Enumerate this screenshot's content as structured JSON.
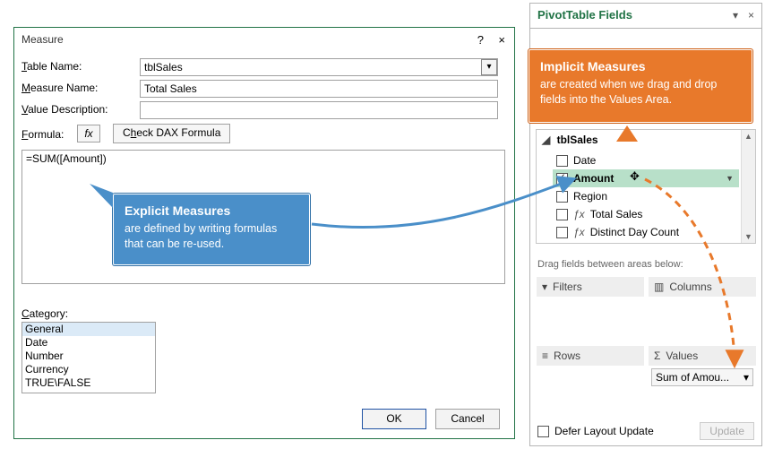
{
  "dialog": {
    "title": "Measure",
    "help": "?",
    "close": "×",
    "tablename_label": "Table Name:",
    "tablename_value": "tblSales",
    "measurename_label": "Measure Name:",
    "measurename_value": "Total Sales",
    "valuedesc_label": "Value Description:",
    "valuedesc_value": "",
    "formula_label": "Formula:",
    "fx_label": "fx",
    "checkdax_label": "Check DAX Formula",
    "formula_text": "=SUM([Amount])",
    "category_label": "Category:",
    "categories": [
      "General",
      "Date",
      "Number",
      "Currency",
      "TRUE\\FALSE"
    ],
    "ok_label": "OK",
    "cancel_label": "Cancel",
    "underline_chars": {
      "tablename": "T",
      "measurename": "M",
      "valuedesc": "V",
      "formula": "F",
      "checkdax": "h",
      "category": "C"
    }
  },
  "pane": {
    "title": "PivotTable Fields",
    "table_header": "tblSales",
    "fields": [
      {
        "name": "Date",
        "checked": false,
        "fx": false
      },
      {
        "name": "Amount",
        "checked": true,
        "fx": false,
        "active": true
      },
      {
        "name": "Region",
        "checked": false,
        "fx": false
      },
      {
        "name": "Total Sales",
        "checked": false,
        "fx": true
      },
      {
        "name": "Distinct Day Count",
        "checked": false,
        "fx": true
      }
    ],
    "drag_hint": "Drag fields between areas below:",
    "zones": {
      "filters": "Filters",
      "columns": "Columns",
      "rows": "Rows",
      "values": "Values"
    },
    "value_item": "Sum of Amou...",
    "defer_label": "Defer Layout Update",
    "update_label": "Update"
  },
  "callouts": {
    "implicit_title": "Implicit Measures",
    "implicit_body": "are created when we drag and drop fields into the Values Area.",
    "explicit_title": "Explicit Measures",
    "explicit_body": "are defined by writing formulas that can be re-used."
  }
}
